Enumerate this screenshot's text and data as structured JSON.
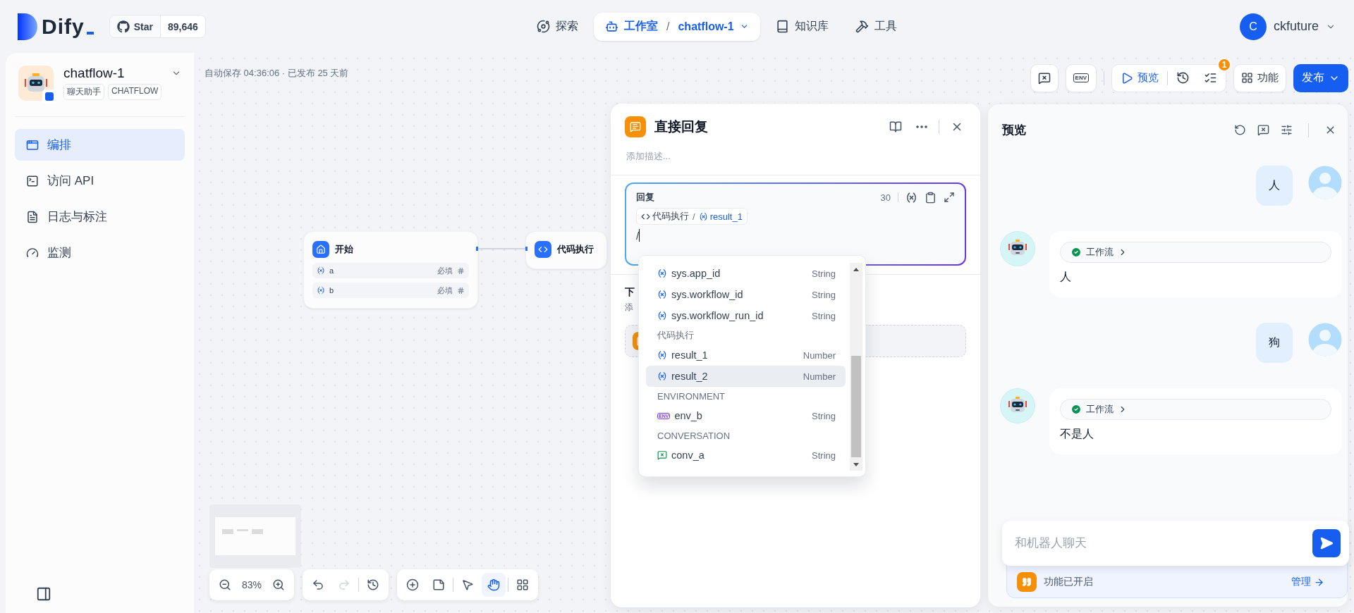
{
  "header": {
    "logo": "Dify",
    "github": {
      "label": "Star",
      "count": "89,646"
    },
    "nav": [
      {
        "label": "探索",
        "selected": false
      },
      {
        "label": "工作室",
        "selected": true,
        "separator": "/",
        "app": "chatflow-1"
      },
      {
        "label": "知识库",
        "selected": false
      },
      {
        "label": "工具",
        "selected": false
      }
    ],
    "user": {
      "initial": "C",
      "name": "ckfuture"
    }
  },
  "sidebar": {
    "app": {
      "name": "chatflow-1",
      "tags": [
        "聊天助手",
        "CHATFLOW"
      ]
    },
    "menu": [
      {
        "label": "编排",
        "selected": true
      },
      {
        "label": "访问 API",
        "selected": false
      },
      {
        "label": "日志与标注",
        "selected": false
      },
      {
        "label": "监测",
        "selected": false
      }
    ]
  },
  "canvas": {
    "autosave": "自动保存 04:36:06 · 已发布 25 天前",
    "toolbar": {
      "env": "ENV",
      "preview": "预览",
      "badge": "1",
      "features": "功能",
      "publish": "发布"
    },
    "nodes": [
      {
        "kind": "start",
        "title": "开始",
        "vars": [
          {
            "name": "a",
            "required": "必填"
          },
          {
            "name": "b",
            "required": "必填"
          }
        ]
      },
      {
        "kind": "code",
        "title": "代码执行"
      }
    ],
    "zoom": "83%",
    "history": [
      {
        "disabled": false
      },
      {
        "disabled": true
      },
      {
        "disabled": false
      }
    ],
    "tools": [
      {
        "selected": false
      },
      {
        "selected": false
      },
      {
        "selected": false
      },
      {
        "selected": true
      },
      {
        "selected": false
      }
    ]
  },
  "node_panel": {
    "title": "直接回复",
    "description_placeholder": "添加描述...",
    "reply": {
      "label": "回复",
      "count": "30",
      "chip": {
        "node": "代码执行",
        "separator": "/",
        "var": "result_1"
      },
      "typed": "/"
    },
    "next": {
      "title": "下",
      "desc": "添"
    },
    "dropdown": [
      {
        "kind": "var",
        "name": "sys.app_id",
        "type": "String",
        "selected": false
      },
      {
        "kind": "var",
        "name": "sys.workflow_id",
        "type": "String",
        "selected": false
      },
      {
        "kind": "var",
        "name": "sys.workflow_run_id",
        "type": "String",
        "selected": false
      },
      {
        "kind": "group",
        "name": "代码执行"
      },
      {
        "kind": "var",
        "name": "result_1",
        "type": "Number",
        "selected": false
      },
      {
        "kind": "var",
        "name": "result_2",
        "type": "Number",
        "selected": true
      },
      {
        "kind": "group",
        "name": "ENVIRONMENT"
      },
      {
        "kind": "env",
        "badge": "ENV",
        "name": "env_b",
        "type": "String",
        "selected": false
      },
      {
        "kind": "group",
        "name": "CONVERSATION"
      },
      {
        "kind": "conv",
        "name": "conv_a",
        "type": "String",
        "selected": false
      }
    ]
  },
  "preview": {
    "title": "预览",
    "messages": [
      {
        "kind": "user",
        "text": "人"
      },
      {
        "kind": "bot",
        "workflow": "工作流",
        "text": "人"
      },
      {
        "kind": "user",
        "text": "狗"
      },
      {
        "kind": "bot",
        "workflow": "工作流",
        "text": "不是人"
      }
    ],
    "input_placeholder": "和机器人聊天",
    "features": {
      "label": "功能已开启",
      "manage": "管理"
    }
  }
}
